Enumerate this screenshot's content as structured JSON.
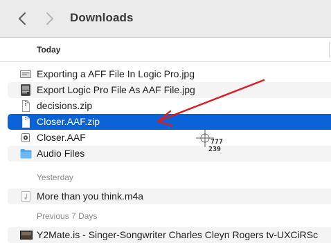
{
  "window": {
    "title": "Downloads"
  },
  "navigation": {
    "back_icon": "chevron-left-icon",
    "forward_icon": "chevron-right-icon"
  },
  "list_header": {
    "column_label": "Today"
  },
  "groups": {
    "yesterday_label": "Yesterday",
    "previous_label": "Previous 7 Days"
  },
  "files": {
    "today": [
      {
        "name": "Exporting a AFF File In Logic Pro.jpg",
        "icon": "image-file-icon"
      },
      {
        "name": "Export Logic Pro File As AAF File.jpg",
        "icon": "image-file-icon"
      },
      {
        "name": "decisions.zip",
        "icon": "zip-file-icon"
      },
      {
        "name": "Closer.AAF.zip",
        "icon": "zip-file-icon",
        "selected": true
      },
      {
        "name": "Closer.AAF",
        "icon": "aaf-file-icon"
      },
      {
        "name": "Audio Files",
        "icon": "folder-icon"
      }
    ],
    "yesterday": [
      {
        "name": "More than you think.m4a",
        "icon": "audio-file-icon"
      }
    ],
    "previous": [
      {
        "name": "Y2Mate.is - Singer-Songwriter Charles Cleyn  Rogers tv-UXCiRSc",
        "icon": "video-file-icon"
      }
    ]
  },
  "cursor_readout": {
    "x": "777",
    "y": "239"
  },
  "colors": {
    "selection": "#0a63d6",
    "annotation_arrow": "#e0191c",
    "folder": "#4aa6f0"
  }
}
